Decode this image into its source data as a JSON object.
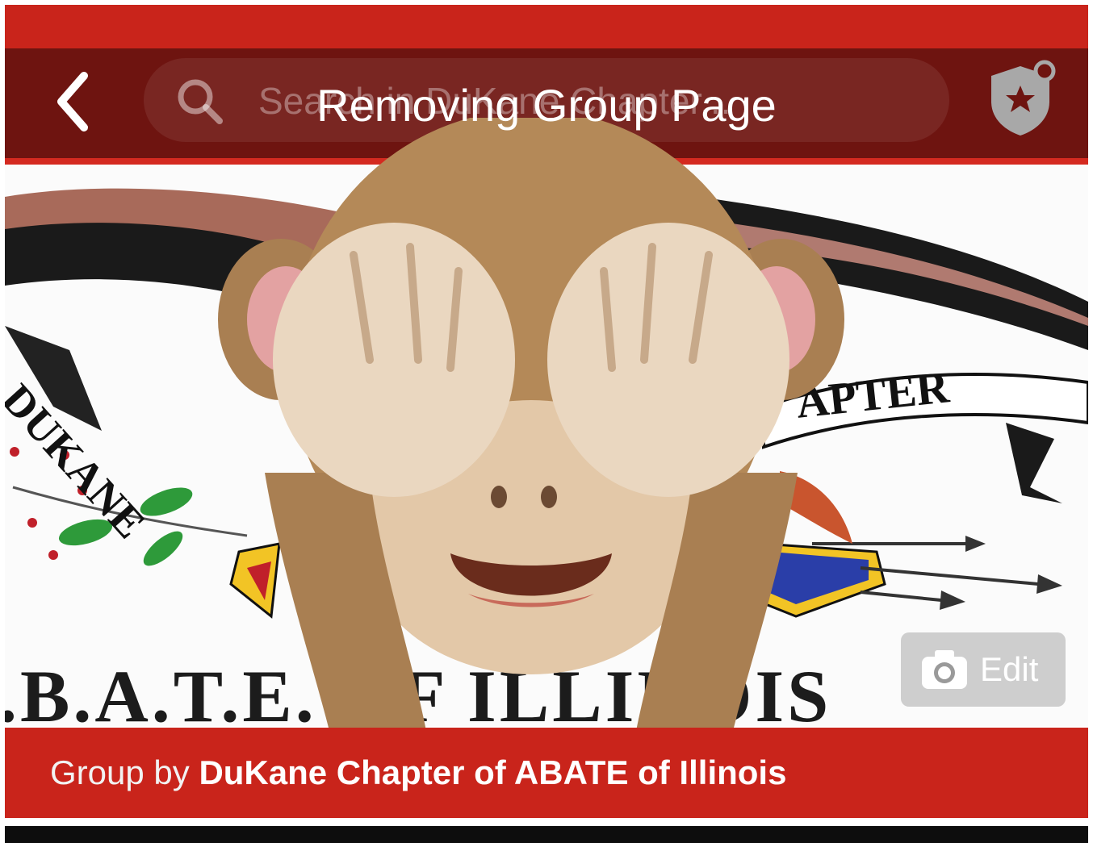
{
  "toast": {
    "text": "Removing Group Page"
  },
  "search": {
    "placeholder": "Search in DuKane Chapter..."
  },
  "cover": {
    "line_text": ".B.A.T.E. OF ILLINOIS",
    "arc_left": "DUKANE",
    "arc_right": "APTER",
    "edit_label": "Edit"
  },
  "footer": {
    "prefix": "Group by ",
    "group_name": "DuKane Chapter of ABATE of Illinois"
  },
  "colors": {
    "brand_red": "#c9241b",
    "nav_dark_red": "#6e1410",
    "monkey_fur": "#b58a5a"
  },
  "icons": [
    "chevron-left-icon",
    "search-icon",
    "shield-star-icon",
    "camera-icon",
    "see-no-evil-monkey-icon"
  ]
}
